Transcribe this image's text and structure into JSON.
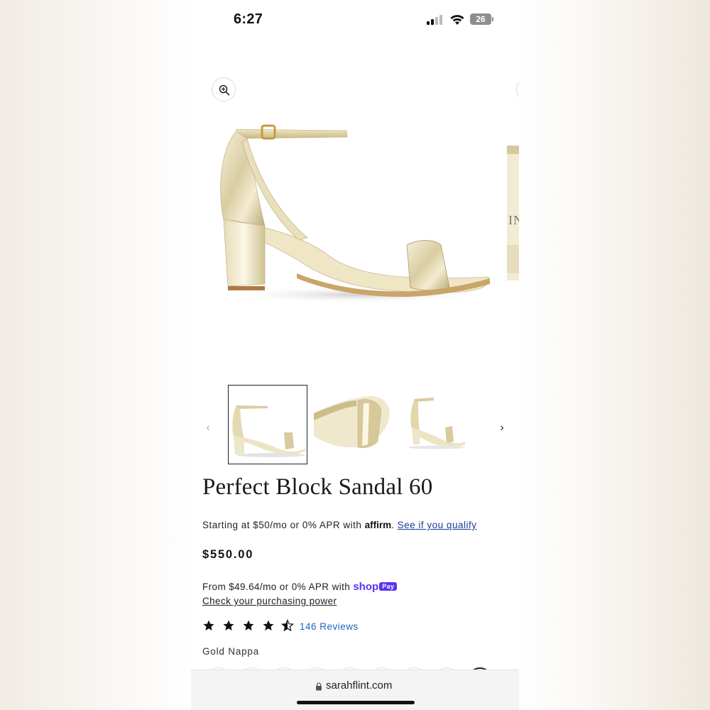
{
  "status_bar": {
    "time": "6:27",
    "battery": "26",
    "icons": [
      "signal-icon",
      "wifi-icon",
      "battery-icon"
    ]
  },
  "gallery": {
    "zoom_icon": "zoom-in-icon",
    "peek_text": "IN",
    "thumbnail_prev_icon": "chevron-left-icon",
    "thumbnail_next_icon": "chevron-right-icon",
    "thumbnail_count": 3,
    "active_thumbnail": 1
  },
  "product": {
    "title": "Perfect Block Sandal 60",
    "affirm": {
      "prefix": "Starting at $50/mo or 0% APR with ",
      "logo": "affirm",
      "link": "See if you qualify"
    },
    "price": "$550.00",
    "shop_pay": {
      "prefix": "From $49.64/mo or 0% APR with ",
      "logo": "shop",
      "badge": "Pay",
      "link": "Check your purchasing power"
    },
    "rating": {
      "stars": 4.5,
      "max": 5,
      "reviews": "146 Reviews"
    },
    "color": "Gold Nappa"
  },
  "browser": {
    "url": "sarahflint.com"
  },
  "colors": {
    "affirm_link": "#1a3a9c",
    "shop_pay": "#5a31f4",
    "reviews_link": "#1f63b8"
  }
}
